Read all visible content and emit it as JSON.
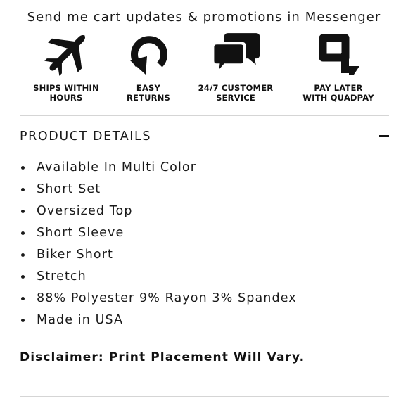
{
  "messenger_optin": {
    "text": "Send me cart updates & promotions in Messenger"
  },
  "features": [
    {
      "icon": "airplane-icon",
      "label": "SHIPS WITHIN\nHOURS"
    },
    {
      "icon": "return-arrow-icon",
      "label": "EASY\nRETURNS"
    },
    {
      "icon": "chat-bubbles-icon",
      "label": "24/7 CUSTOMER\nSERVICE"
    },
    {
      "icon": "quadpay-logo-icon",
      "label": "PAY LATER\nWITH QUADPAY"
    }
  ],
  "product_details": {
    "title": "PRODUCT DETAILS",
    "toggle_icon": "minus-icon",
    "items": [
      "Available In Multi Color",
      "Short Set",
      "Oversized Top",
      "Short Sleeve",
      "Biker Short",
      "Stretch",
      "88% Polyester 9% Rayon 3% Spandex",
      "Made in USA"
    ],
    "disclaimer": "Disclaimer: Print Placement Will Vary."
  },
  "colors": {
    "text": "#111111",
    "divider": "#d5d5d5",
    "background": "#ffffff"
  }
}
